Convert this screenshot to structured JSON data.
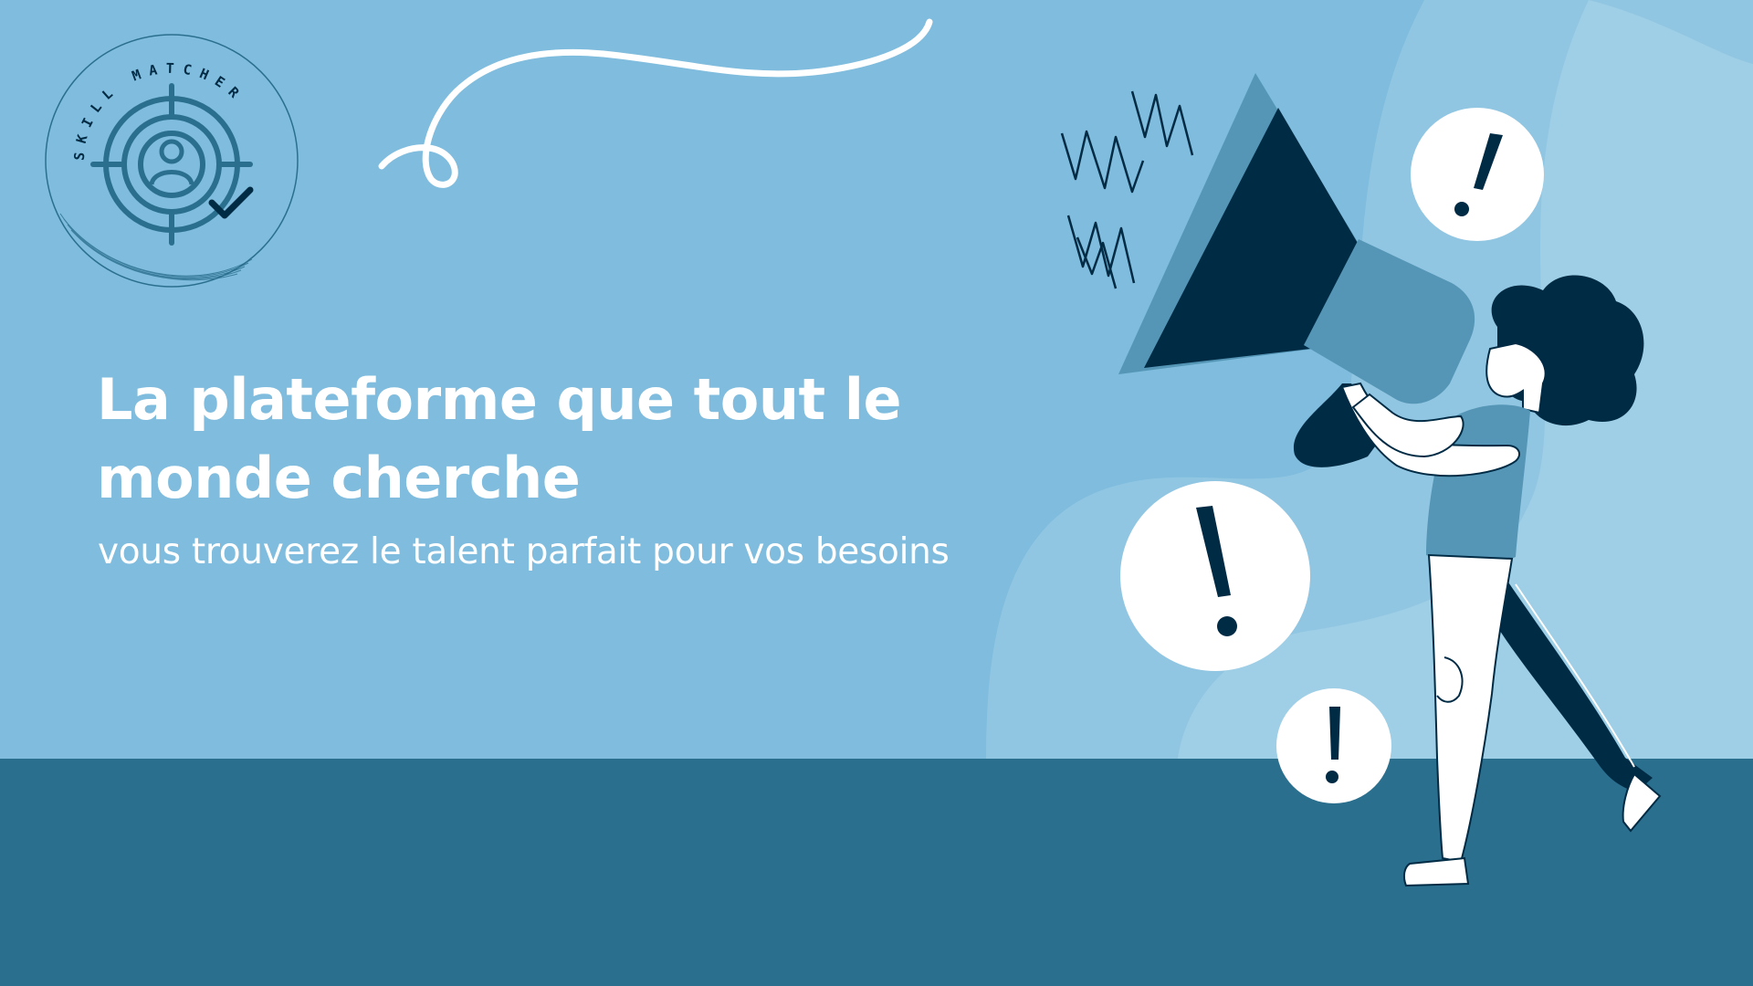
{
  "logo": {
    "ring_text": "SKILL MATCHER",
    "icon": "target-user-check-icon"
  },
  "hero": {
    "title_line1": "La plateforme que tout le",
    "title_line2": "monde cherche",
    "subtitle": "vous trouverez le talent parfait pour vos besoins"
  },
  "illustration": {
    "subject": "woman-megaphone-illustration",
    "alert_icon": "exclamation-icon"
  },
  "colors": {
    "background": "#7fbcdd",
    "floor": "#2b6f8e",
    "navy": "#002b45",
    "mid_blue": "#5596b6",
    "text": "#ffffff"
  }
}
